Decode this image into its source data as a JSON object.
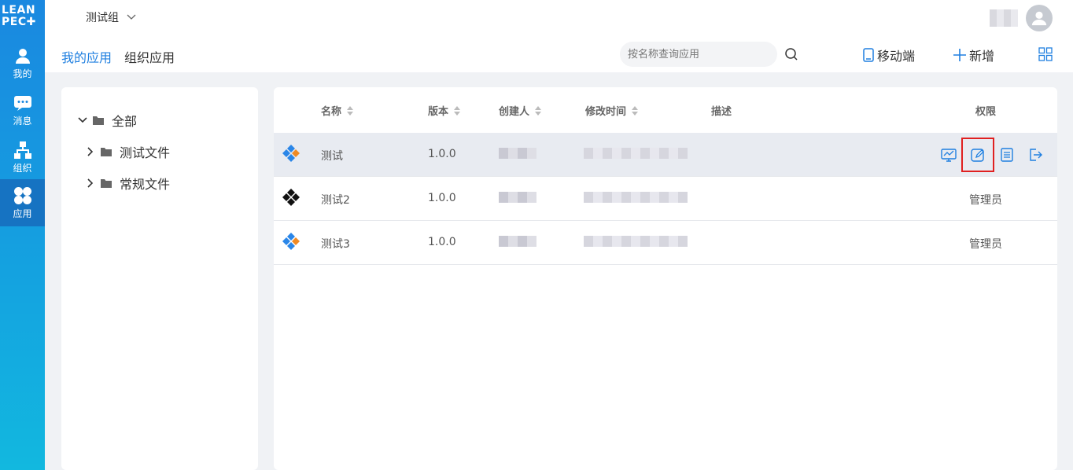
{
  "brand": {
    "logo_line1": "LEAN",
    "logo_line2": "PEC✚"
  },
  "rail": {
    "items": [
      {
        "label": "我的",
        "icon": "user-icon"
      },
      {
        "label": "消息",
        "icon": "message-icon"
      },
      {
        "label": "组织",
        "icon": "org-icon"
      },
      {
        "label": "应用",
        "icon": "apps-icon",
        "active": true
      }
    ]
  },
  "header": {
    "group_name": "测试组",
    "tabs": [
      {
        "label": "我的应用",
        "active": true
      },
      {
        "label": "组织应用"
      }
    ],
    "search_placeholder": "按名称查询应用",
    "mobile_label": "移动端",
    "add_label": "新增"
  },
  "tree": {
    "root": "全部",
    "children": [
      "测试文件",
      "常规文件"
    ]
  },
  "table": {
    "columns": {
      "name": "名称",
      "version": "版本",
      "creator": "创建人",
      "modified": "修改时间",
      "desc": "描述",
      "perm": "权限"
    },
    "rows": [
      {
        "name": "测试",
        "version": "1.0.0",
        "perm": "",
        "icon_color": "#2a86e8",
        "hover": true
      },
      {
        "name": "测试2",
        "version": "1.0.0",
        "perm": "管理员",
        "icon_color": "#111111"
      },
      {
        "name": "测试3",
        "version": "1.0.0",
        "perm": "管理员",
        "icon_color": "#2a86e8"
      }
    ],
    "row_actions": [
      "monitor-icon",
      "edit-icon",
      "document-icon",
      "exit-icon"
    ]
  },
  "colors": {
    "accent": "#1f7fe0",
    "highlight": "#e02020",
    "rail_top": "#1a88e0",
    "rail_bottom": "#12b8df"
  }
}
